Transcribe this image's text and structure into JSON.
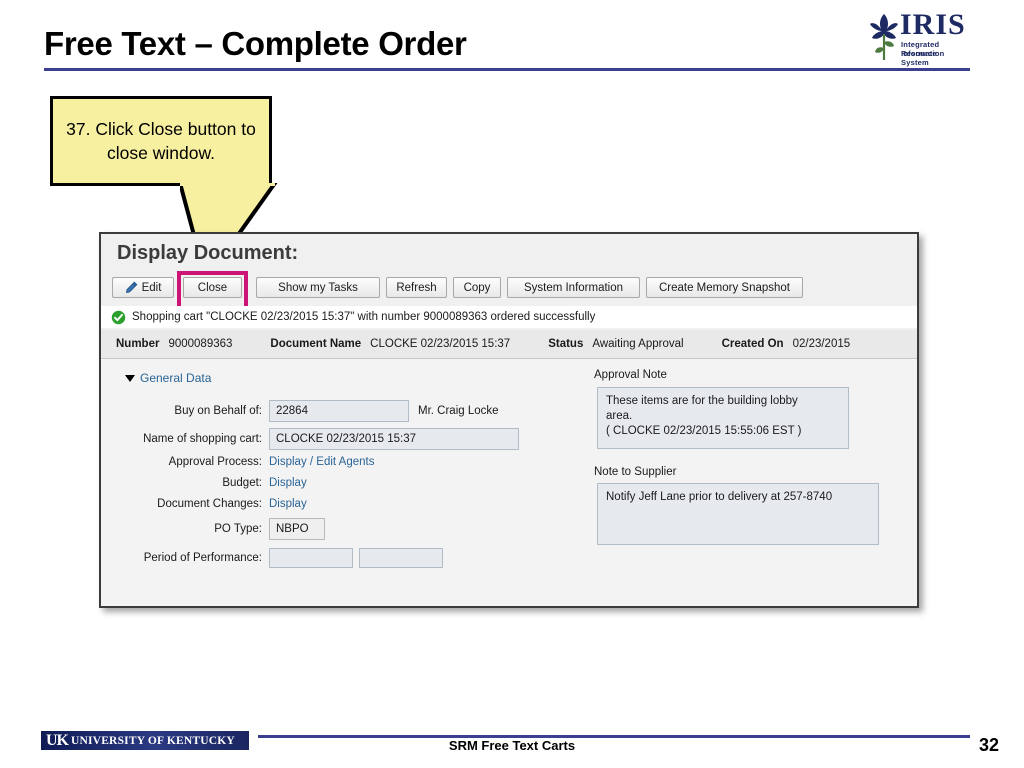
{
  "slide": {
    "title": "Free Text – Complete Order",
    "page_number": "32",
    "footer_center": "SRM Free Text Carts",
    "accent_color": "#3b3f8f",
    "highlight_color": "#cc1477",
    "callout_color": "#f7f0a0"
  },
  "iris_logo": {
    "wordmark": "IRIS",
    "line1": "Integrated Resource",
    "line2": "Information System",
    "icon": "iris-flower-icon"
  },
  "uk_logo": {
    "mark": "UK",
    "name": "UNIVERSITY OF KENTUCKY"
  },
  "callout": {
    "text": "37. Click Close button to close window."
  },
  "app": {
    "heading": "Display Document:",
    "toolbar": {
      "edit_label": "Edit",
      "close_label": "Close",
      "tasks_label": "Show my Tasks",
      "refresh_label": "Refresh",
      "copy_label": "Copy",
      "system_information_label": "System Information",
      "create_memory_snapshot_label": "Create Memory Snapshot"
    },
    "message": {
      "icon": "success-check-icon",
      "text": "Shopping cart \"CLOCKE 02/23/2015 15:37\" with number 9000089363 ordered successfully"
    },
    "summary": {
      "number_label": "Number",
      "number_value": "9000089363",
      "document_name_label": "Document Name",
      "document_name_value": "CLOCKE 02/23/2015 15:37",
      "status_label": "Status",
      "status_value": "Awaiting Approval",
      "created_on_label": "Created On",
      "created_on_value": "02/23/2015"
    },
    "general_data": {
      "section_label": "General Data",
      "buy_on_behalf_label": "Buy on Behalf of:",
      "buy_on_behalf_value": "22864",
      "buy_on_behalf_name": "Mr. Craig Locke",
      "cart_name_label": "Name of shopping cart:",
      "cart_name_value": "CLOCKE 02/23/2015 15:37",
      "approval_process_label": "Approval Process:",
      "approval_process_link": "Display / Edit Agents",
      "budget_label": "Budget:",
      "budget_link": "Display",
      "document_changes_label": "Document Changes:",
      "document_changes_link": "Display",
      "po_type_label": "PO Type:",
      "po_type_value": "NBPO",
      "period_of_performance_label": "Period of Performance:",
      "period_from_value": "",
      "period_to_value": ""
    },
    "notes": {
      "approval_note_label": "Approval Note",
      "approval_note_line1": "These items are for the building lobby",
      "approval_note_line2": "area.",
      "approval_note_line3": "( CLOCKE 02/23/2015 15:55:06 EST )",
      "supplier_note_label": "Note to Supplier",
      "supplier_note_text": "Notify Jeff Lane prior to delivery at 257-8740"
    }
  }
}
